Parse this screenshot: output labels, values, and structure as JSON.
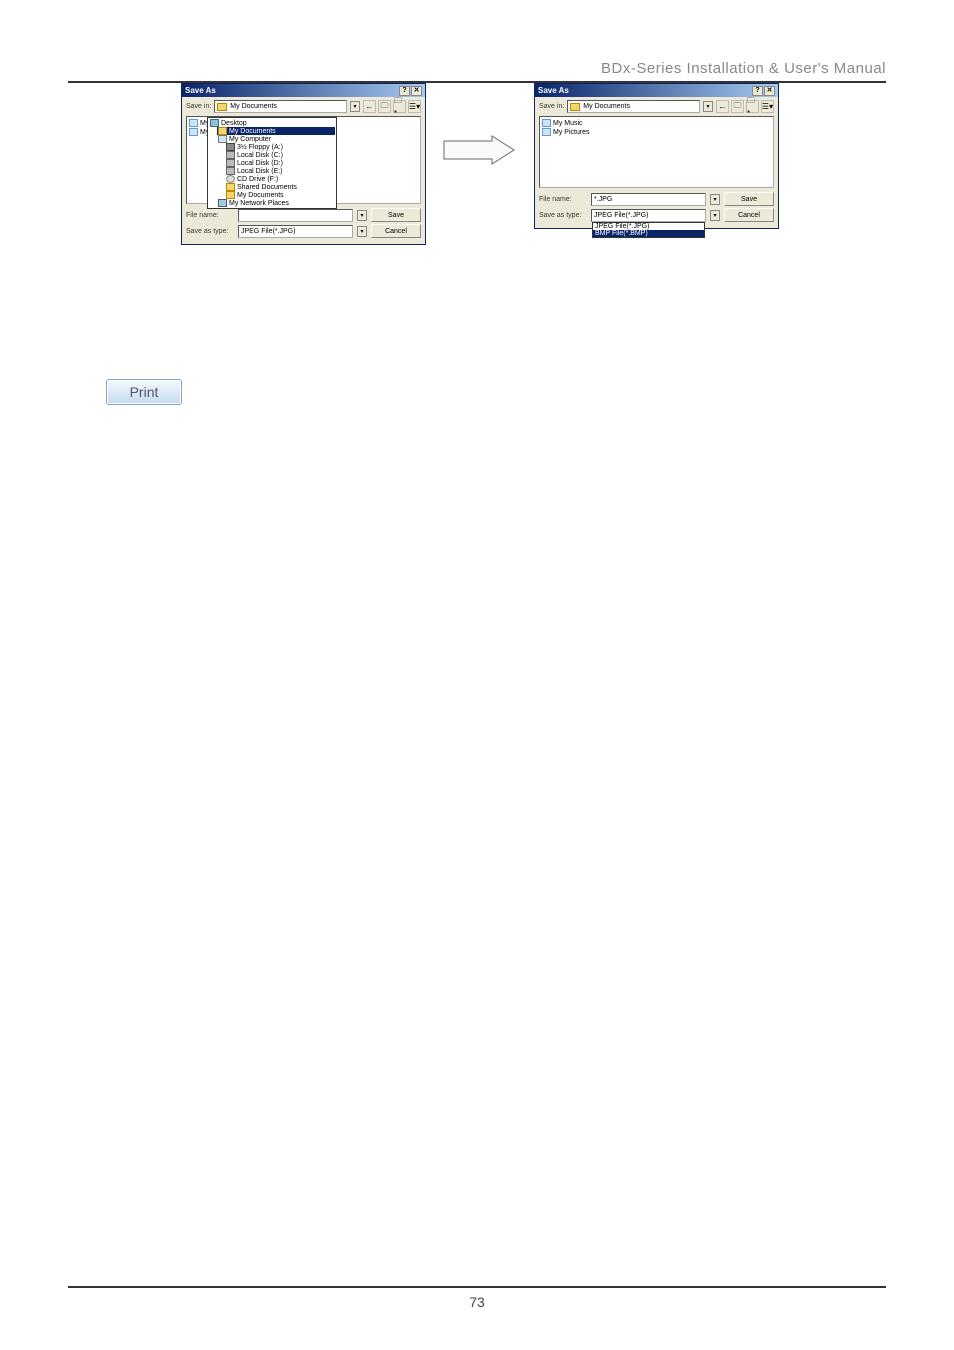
{
  "header": {
    "title": "BDx-Series Installation & User's Manual"
  },
  "dialog_left": {
    "title": "Save As",
    "savein_label": "Save in:",
    "savein_value": "My Documents",
    "file_items": [
      "My Mu",
      "My Pic"
    ],
    "dropdown": {
      "desktop": "Desktop",
      "mydocs": "My Documents",
      "mycomp": "My Computer",
      "floppy": "3½ Floppy (A:)",
      "diskC": "Local Disk (C:)",
      "diskD": "Local Disk (D:)",
      "diskE": "Local Disk (E:)",
      "cd": "CD Drive (F:)",
      "shared": "Shared Documents",
      "mydocs2": "My Documents",
      "netplaces": "My Network Places"
    },
    "filename_label": "File name:",
    "filename_value": "",
    "savetype_label": "Save as type:",
    "savetype_value": "JPEG File(*.JPG)",
    "save_btn": "Save",
    "cancel_btn": "Cancel"
  },
  "dialog_right": {
    "title": "Save As",
    "savein_label": "Save in:",
    "savein_value": "My Documents",
    "file_items": [
      "My Music",
      "My Pictures"
    ],
    "filename_label": "File name:",
    "filename_value": "*.JPG",
    "savetype_label": "Save as type:",
    "savetype_value": "JPEG File(*.JPG)",
    "type_options": [
      "JPEG File(*.JPG)",
      "BMP File(*.BMP)"
    ],
    "save_btn": "Save",
    "cancel_btn": "Cancel"
  },
  "buttons": {
    "print": "Print"
  },
  "footer": {
    "page_number": "73"
  }
}
